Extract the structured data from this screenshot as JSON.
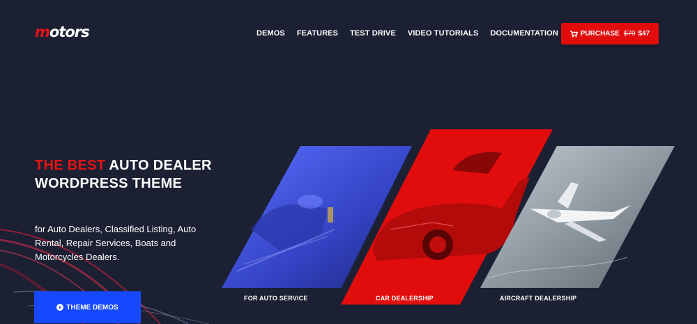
{
  "header": {
    "logo": {
      "first_letter": "m",
      "rest": "otors"
    },
    "nav": [
      "DEMOS",
      "FEATURES",
      "TEST DRIVE",
      "VIDEO TUTORIALS",
      "DOCUMENTATION"
    ],
    "purchase": {
      "label": "PURCHASE",
      "old_price": "$79",
      "price": "$47",
      "icon": "cart-icon"
    }
  },
  "hero": {
    "headline_accent": "THE BEST",
    "headline_rest": " AUTO DEALER WORDPRESS THEME",
    "description": "for Auto Dealers, Classified Listing, Auto Rental, Repair Services, Boats and Motorcycles Dealers.",
    "cta": {
      "label": "THEME DEMOS",
      "icon": "play-icon"
    }
  },
  "panels": [
    {
      "label": "FOR AUTO SERVICE",
      "color": "#3a4fd6"
    },
    {
      "label": "CAR DEALERSHIP",
      "color": "#e10d0d"
    },
    {
      "label": "AIRCRAFT DEALERSHIP",
      "color": "#8a96a0"
    }
  ],
  "colors": {
    "background": "#1b2033",
    "accent": "#e41414",
    "button_blue": "#1649ff"
  }
}
